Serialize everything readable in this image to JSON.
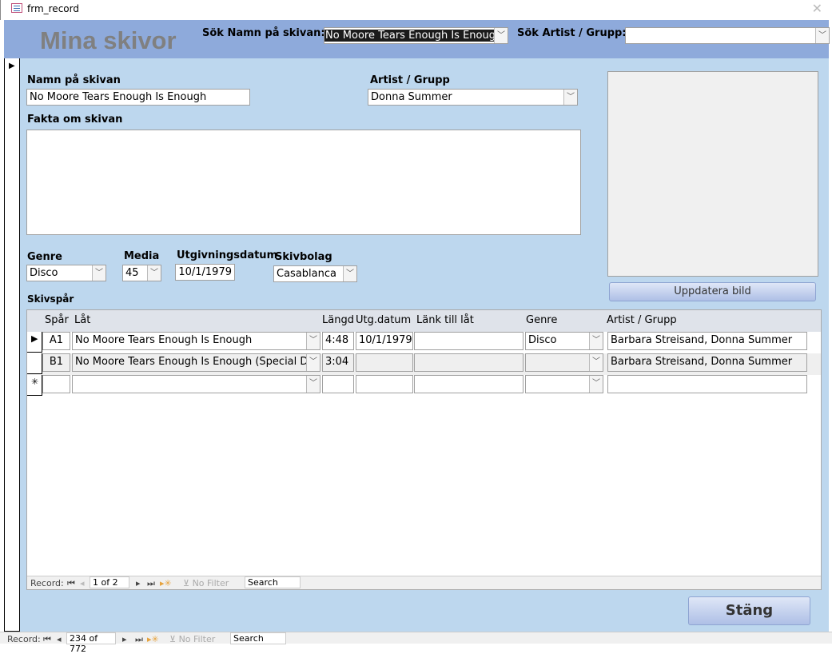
{
  "window": {
    "title": "frm_record"
  },
  "header": {
    "title": "Mina skivor",
    "search_name_label": "Sök Namn på skivan:",
    "search_name_value": "No Moore Tears Enough Is Enough",
    "search_artist_label": "Sök Artist / Grupp:",
    "search_artist_value": ""
  },
  "form": {
    "name_label": "Namn på skivan",
    "name_value": "No Moore Tears Enough Is Enough",
    "artist_label": "Artist / Grupp",
    "artist_value": "Donna Summer",
    "facts_label": "Fakta om skivan",
    "facts_value": "",
    "genre_label": "Genre",
    "genre_value": "Disco",
    "media_label": "Media",
    "media_value": "45",
    "date_label": "Utgivningsdatum",
    "date_value": "10/1/1979",
    "label_label": "Skivbolag",
    "label_value": "Casablanca",
    "update_image_button": "Uppdatera bild",
    "tracks_label": "Skivspår",
    "close_button": "Stäng"
  },
  "tracks": {
    "columns": [
      "Spår",
      "Låt",
      "Längd",
      "Utg.datum",
      "Länk till låt",
      "Genre",
      "Artist / Grupp"
    ],
    "rows": [
      {
        "track": "A1",
        "song": "No Moore Tears Enough Is Enough",
        "length": "4:48",
        "date": "10/1/1979",
        "link": "",
        "genre": "Disco",
        "artist": "Barbara Streisand, Donna Summer"
      },
      {
        "track": "B1",
        "song": "No Moore Tears Enough Is Enough (Special Disc",
        "length": "3:04",
        "date": "",
        "link": "",
        "genre": "",
        "artist": "Barbara Streisand, Donna Summer"
      }
    ],
    "nav": {
      "record_label": "Record:",
      "position": "1 of 2",
      "filter": "No Filter",
      "search": "Search"
    }
  },
  "main_nav": {
    "record_label": "Record:",
    "position": "234 of 772",
    "filter": "No Filter",
    "search": "Search"
  }
}
